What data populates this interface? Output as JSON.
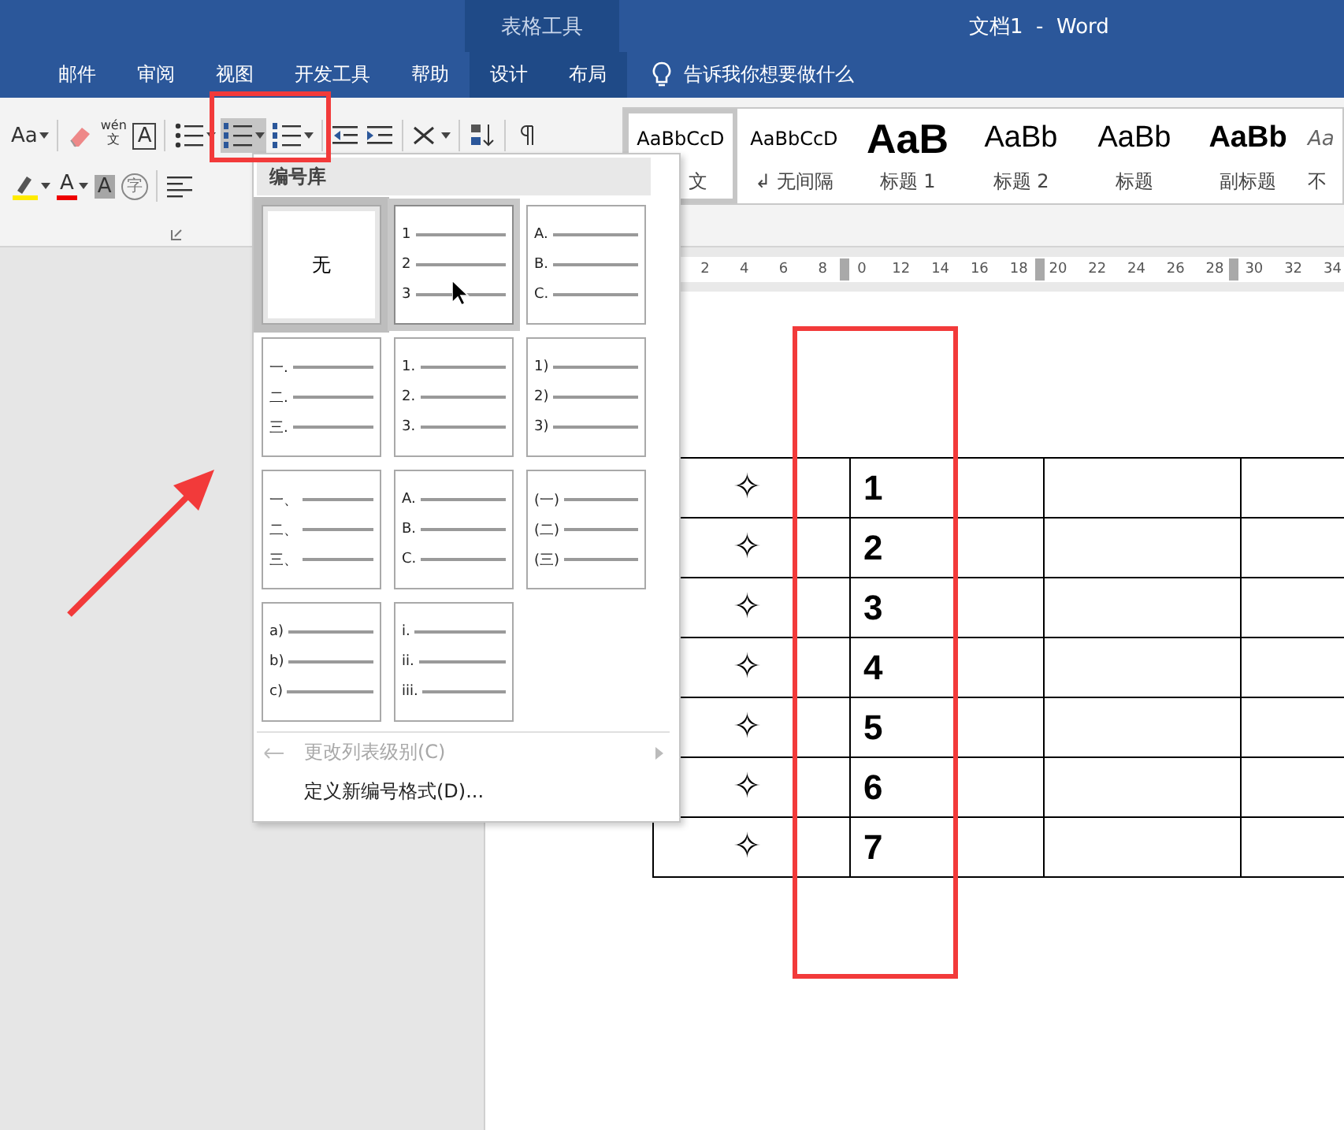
{
  "window": {
    "context_label": "表格工具",
    "title": "文档1  -  Word"
  },
  "tabs": [
    {
      "label": "邮件",
      "contextual": false
    },
    {
      "label": "审阅",
      "contextual": false
    },
    {
      "label": "视图",
      "contextual": false
    },
    {
      "label": "开发工具",
      "contextual": false
    },
    {
      "label": "帮助",
      "contextual": false
    },
    {
      "label": "设计",
      "contextual": true
    },
    {
      "label": "布局",
      "contextual": true
    }
  ],
  "tell_me": {
    "placeholder": "告诉我你想要做什么"
  },
  "ribbon": {
    "row_1": [
      {
        "kind": "font-case",
        "label": "Aa"
      },
      {
        "kind": "separator"
      },
      {
        "kind": "eraser"
      },
      {
        "kind": "phonetic",
        "label": "wén",
        "sub": "文"
      },
      {
        "kind": "char-border",
        "label": "A"
      },
      {
        "kind": "separator"
      },
      {
        "kind": "bullets",
        "selected": false
      },
      {
        "kind": "numbering",
        "selected": true
      },
      {
        "kind": "multilevel",
        "selected": false
      },
      {
        "kind": "separator"
      },
      {
        "kind": "outdent"
      },
      {
        "kind": "indent"
      },
      {
        "kind": "separator"
      },
      {
        "kind": "asian-layout"
      },
      {
        "kind": "separator"
      },
      {
        "kind": "sort"
      },
      {
        "kind": "separator"
      },
      {
        "kind": "marks"
      }
    ],
    "row_2": [
      {
        "kind": "highlight"
      },
      {
        "kind": "font-color",
        "label": "A"
      },
      {
        "kind": "char-shading",
        "label": "A"
      },
      {
        "kind": "enclose",
        "label": "字"
      },
      {
        "kind": "separator"
      },
      {
        "kind": "align-left"
      }
    ]
  },
  "styles": [
    {
      "kind": "normal",
      "preview": "AaBbCcD",
      "name": "文",
      "selected": true
    },
    {
      "kind": "normal",
      "preview": "AaBbCcD",
      "name": "↲ 无间隔",
      "selected": false
    },
    {
      "kind": "heading-1",
      "preview": "AaB",
      "name": "标题 1",
      "selected": false
    },
    {
      "kind": "heading",
      "preview": "AaBb",
      "name": "标题 2",
      "selected": false
    },
    {
      "kind": "heading",
      "preview": "AaBb",
      "name": "标题",
      "selected": false
    },
    {
      "kind": "subtitle",
      "preview": "AaBb",
      "name": "副标题",
      "selected": false
    },
    {
      "kind": "emphasis",
      "preview": "Aa",
      "name": "不",
      "selected": false
    }
  ],
  "ruler": {
    "ticks": [
      "2",
      "4",
      "6",
      "8",
      "0",
      "12",
      "14",
      "16",
      "18",
      "20",
      "22",
      "24",
      "26",
      "28",
      "30",
      "32",
      "34"
    ]
  },
  "table": {
    "rows": [
      {
        "symbol": "✧",
        "number": "1"
      },
      {
        "symbol": "✧",
        "number": "2"
      },
      {
        "symbol": "✧",
        "number": "3"
      },
      {
        "symbol": "✧",
        "number": "4"
      },
      {
        "symbol": "✧",
        "number": "5"
      },
      {
        "symbol": "✧",
        "number": "6"
      },
      {
        "symbol": "✧",
        "number": "7"
      }
    ]
  },
  "numbering_menu": {
    "title": "编号库",
    "formats": [
      {
        "kind": "none",
        "label": "无",
        "selected": true,
        "hovered": false
      },
      {
        "kind": "list",
        "markers": [
          "1",
          "2",
          "3"
        ],
        "selected": false,
        "hovered": true
      },
      {
        "kind": "list",
        "markers": [
          "A.",
          "B.",
          "C."
        ],
        "selected": false,
        "hovered": false
      },
      {
        "kind": "list",
        "markers": [
          "一.",
          "二.",
          "三."
        ],
        "selected": false,
        "hovered": false
      },
      {
        "kind": "list",
        "markers": [
          "1.",
          "2.",
          "3."
        ],
        "selected": false,
        "hovered": false
      },
      {
        "kind": "list",
        "markers": [
          "1)",
          "2)",
          "3)"
        ],
        "selected": false,
        "hovered": false
      },
      {
        "kind": "list",
        "markers": [
          "一、",
          "二、",
          "三、"
        ],
        "selected": false,
        "hovered": false
      },
      {
        "kind": "list",
        "markers": [
          "A.",
          "B.",
          "C."
        ],
        "selected": false,
        "hovered": false
      },
      {
        "kind": "list",
        "markers": [
          "(一)",
          "(二)",
          "(三)"
        ],
        "selected": false,
        "hovered": false
      },
      {
        "kind": "list",
        "markers": [
          "a)",
          "b)",
          "c)"
        ],
        "selected": false,
        "hovered": false
      },
      {
        "kind": "list",
        "markers": [
          "i.",
          "ii.",
          "iii."
        ],
        "selected": false,
        "hovered": false
      }
    ],
    "items": [
      {
        "label": "更改列表级别(C)",
        "disabled": true,
        "submenu": true
      },
      {
        "label": "定义新编号格式(D)...",
        "disabled": false,
        "submenu": false
      }
    ]
  }
}
